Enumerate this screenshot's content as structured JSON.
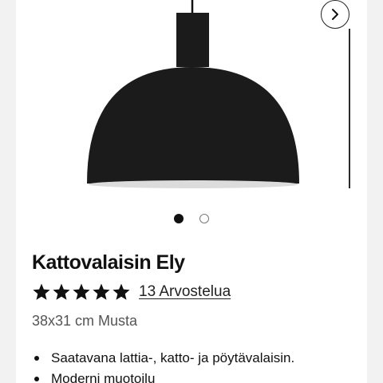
{
  "product": {
    "title": "Kattovalaisin Ely",
    "rating": {
      "stars": 5,
      "max_stars": 5,
      "reviews_label": "13 Arvostelua"
    },
    "variant": "38x31 cm Musta",
    "features": [
      "Saatavana lattia-, katto- ja pöytävalaisin.",
      "Moderni muotoilu"
    ]
  },
  "carousel": {
    "image_count": 2,
    "active_index": 0,
    "next_icon": "chevron-right-icon"
  },
  "colors": {
    "lamp": "#1b1b1b",
    "text": "#111111",
    "muted": "#555555"
  }
}
